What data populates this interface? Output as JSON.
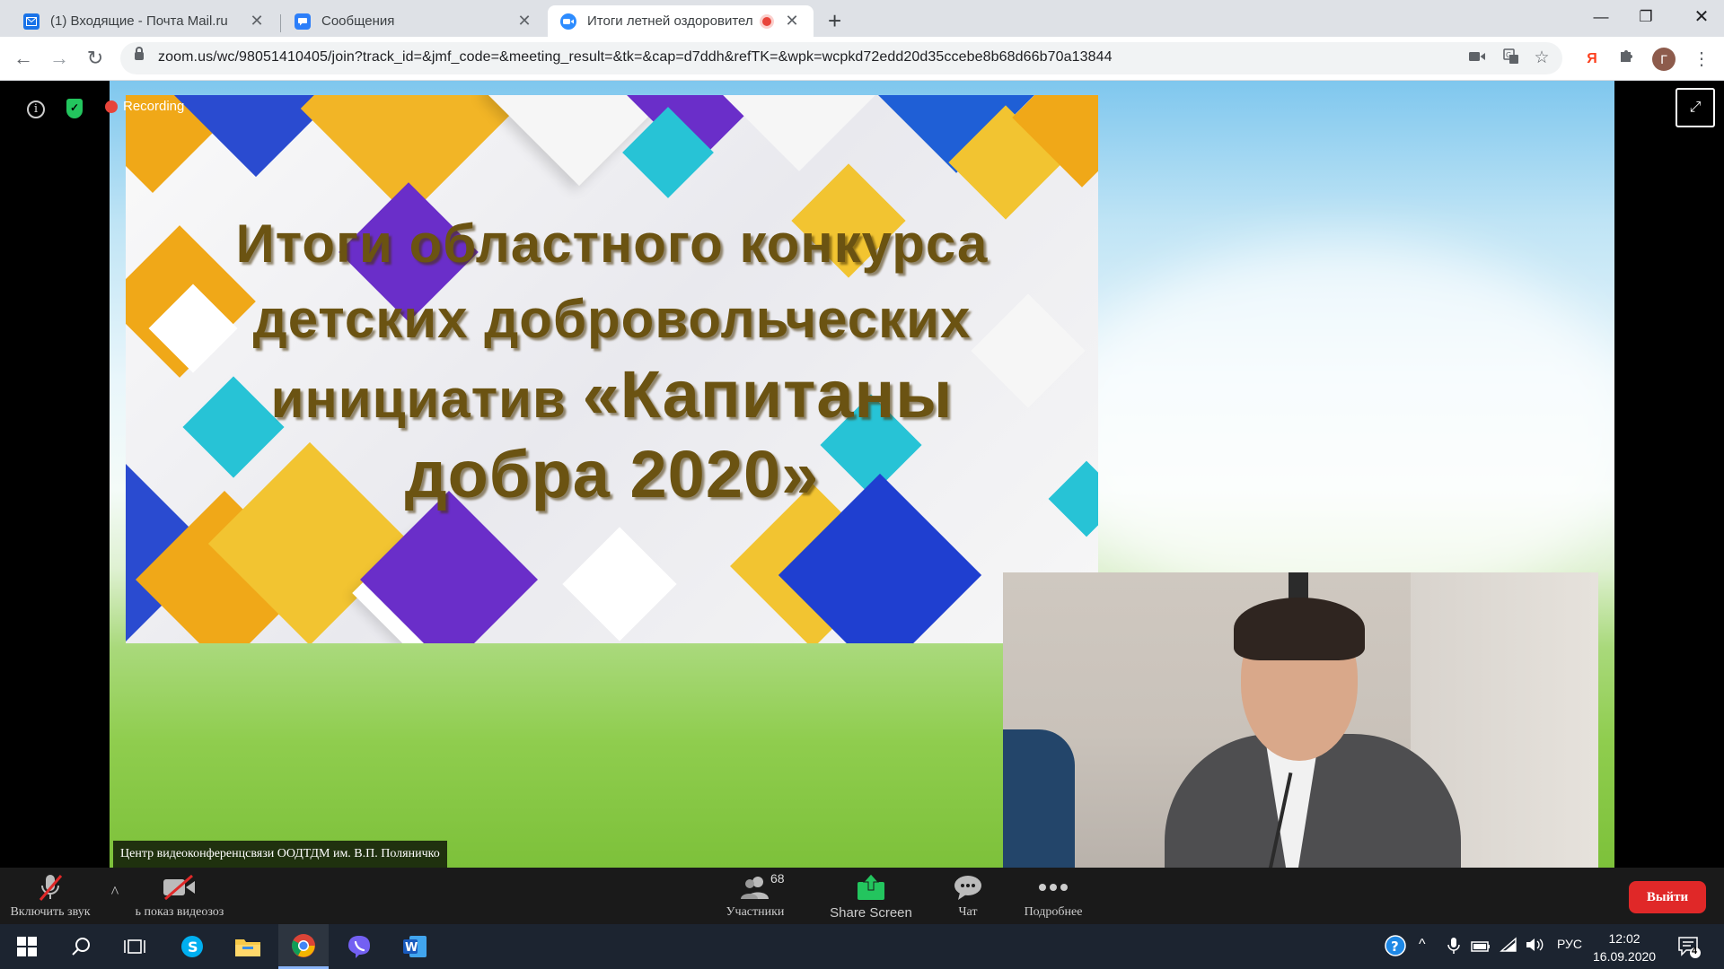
{
  "browser": {
    "tabs": [
      {
        "title": "(1) Входящие - Почта Mail.ru",
        "favicon": "mail-icon",
        "active": false
      },
      {
        "title": "Сообщения",
        "favicon": "messages-icon",
        "active": false
      },
      {
        "title": "Итоги летней оздоровител",
        "favicon": "zoom-icon",
        "active": true,
        "recording": true
      }
    ],
    "new_tab_glyph": "+",
    "url": "zoom.us/wc/98051410405/join?track_id=&jmf_code=&meeting_result=&tk=&cap=d7ddh&refTK=&wpk=wcpkd72edd20d35ccebe8b68d66b70a13844",
    "profile_initial": "Г",
    "yandex_glyph": "Я"
  },
  "meeting": {
    "recording_label": "Recording",
    "slide": {
      "line1": "Итоги областного конкурса",
      "line2": "детских добровольческих",
      "line3_a": "инициатив ",
      "line3_b": "«Капитаны",
      "line4": "добра 2020»"
    },
    "caption": "Центр видеоконференцсвязи ООДТДМ им. В.П. Поляничко"
  },
  "controls": {
    "unmute_label": "Включить звук",
    "video_label": "ь показ видеозоз",
    "participants_label": "Участники",
    "participants_count": "68",
    "share_label": "Share Screen",
    "chat_label": "Чат",
    "more_label": "Подробнее",
    "leave_label": "Выйти"
  },
  "taskbar": {
    "lang": "РУС",
    "time": "12:02",
    "date": "16.09.2020",
    "notifications": "4"
  },
  "colors": {
    "zoom_blue": "#2d8cff",
    "leave_red": "#e02828",
    "share_green": "#23c55e",
    "slide_text": "#6b5312"
  }
}
